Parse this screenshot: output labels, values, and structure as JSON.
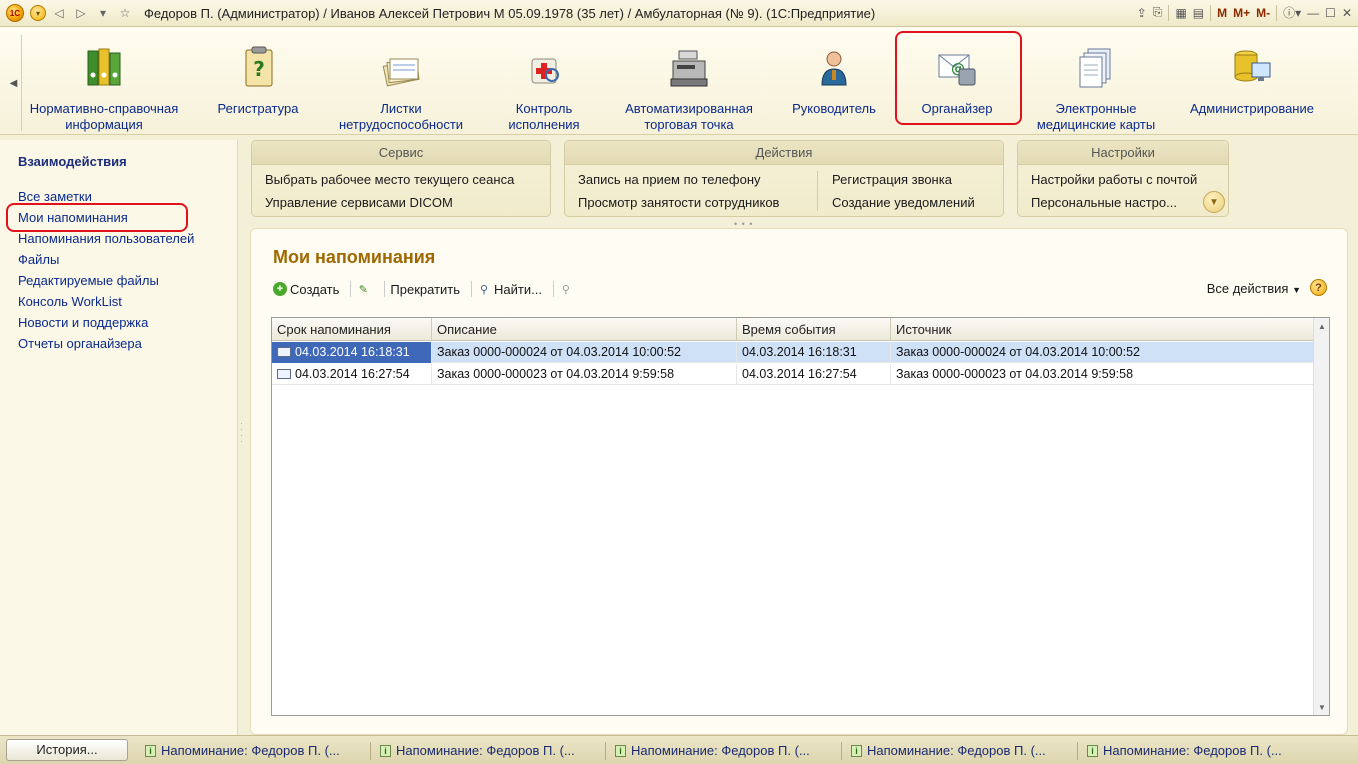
{
  "window": {
    "title": "Федоров П. (Администратор) / Иванов Алексей Петрович М 05.09.1978 (35 лет) / Амбулаторная (№ 9).  (1С:Предприятие)",
    "logo_text": "1С",
    "right_buttons": [
      "M",
      "M+",
      "M-"
    ]
  },
  "sections": [
    {
      "label": "Нормативно-справочная информация",
      "icon": "binders-icon"
    },
    {
      "label": "Регистратура",
      "icon": "clipboard-question-icon"
    },
    {
      "label": "Листки нетрудоспособности",
      "icon": "papers-icon"
    },
    {
      "label": "Контроль исполнения",
      "icon": "medkit-icon"
    },
    {
      "label": "Автоматизированная торговая точка",
      "icon": "cash-register-icon"
    },
    {
      "label": "Руководитель",
      "icon": "person-icon"
    },
    {
      "label": "Органайзер",
      "icon": "organizer-mail-icon"
    },
    {
      "label": "Электронные медицинские карты",
      "icon": "documents-icon"
    },
    {
      "label": "Администрирование",
      "icon": "database-monitor-icon"
    }
  ],
  "leftnav": {
    "heading": "Взаимодействия",
    "items": [
      "Все заметки",
      "Мои напоминания",
      "Напоминания пользователей",
      "Файлы",
      "Редактируемые файлы",
      "Консоль WorkList",
      "Новости и поддержка",
      "Отчеты органайзера"
    ]
  },
  "groups": {
    "service": {
      "title": "Сервис",
      "items": [
        "Выбрать рабочее место текущего сеанса",
        "Управление сервисами DICOM"
      ]
    },
    "actions": {
      "title": "Действия",
      "items": [
        "Запись на прием по телефону",
        "Регистрация звонка",
        "Просмотр занятости сотрудников",
        "Создание уведомлений"
      ]
    },
    "settings": {
      "title": "Настройки",
      "items": [
        "Настройки работы с почтой",
        "Персональные настро..."
      ]
    }
  },
  "form": {
    "title": "Мои напоминания",
    "toolbar": {
      "create": "Создать",
      "stop": "Прекратить",
      "find": "Найти...",
      "all_actions": "Все действия"
    },
    "table": {
      "columns": [
        "Срок напоминания",
        "Описание",
        "Время события",
        "Источник"
      ],
      "rows": [
        [
          "04.03.2014 16:18:31",
          "Заказ 0000-000024 от 04.03.2014 10:00:52",
          "04.03.2014 16:18:31",
          "Заказ 0000-000024 от 04.03.2014 10:00:52"
        ],
        [
          "04.03.2014 16:27:54",
          "Заказ 0000-000023 от 04.03.2014 9:59:58",
          "04.03.2014 16:27:54",
          "Заказ 0000-000023 от 04.03.2014 9:59:58"
        ]
      ]
    }
  },
  "taskbar": {
    "history": "История...",
    "tasks": [
      "Напоминание: Федоров П. (...",
      "Напоминание: Федоров П. (...",
      "Напоминание: Федоров П. (...",
      "Напоминание: Федоров П. (...",
      "Напоминание: Федоров П. (..."
    ]
  },
  "colors": {
    "accent_title": "#a06800",
    "link": "#0b2a8c",
    "highlight_red": "#e0121b",
    "selected_row": "#cfe1f7",
    "focused_cell": "#3f68b8"
  }
}
